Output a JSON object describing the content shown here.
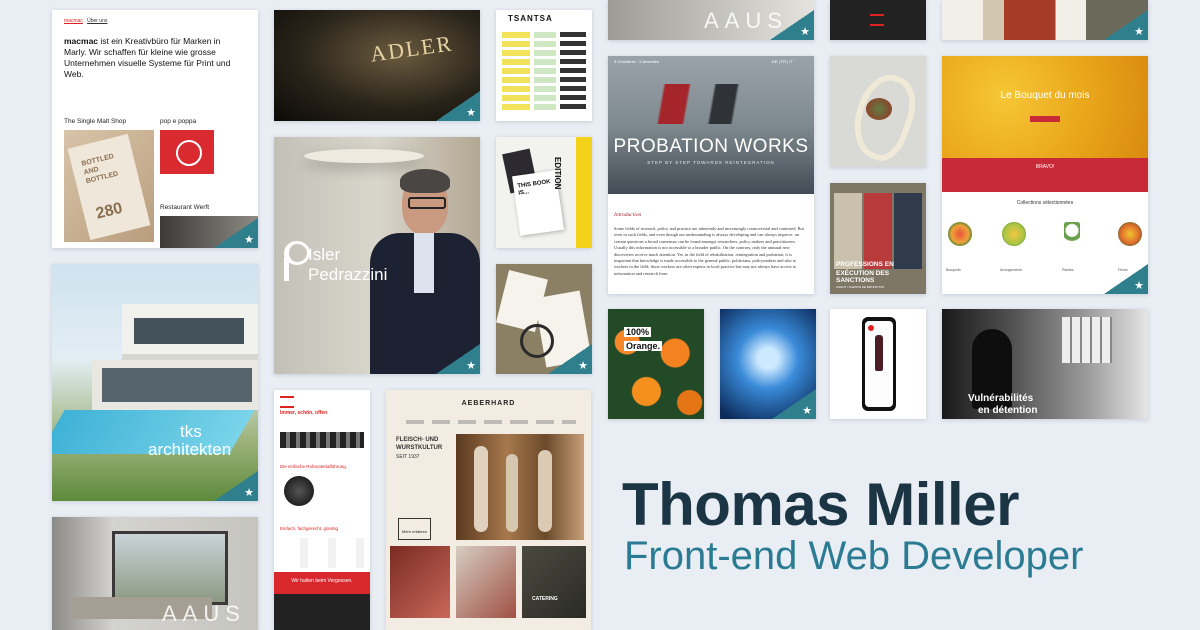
{
  "hero": {
    "name": "Thomas Miller",
    "role": "Front-end Web Developer"
  },
  "tiles": {
    "macmac": {
      "nav": [
        "macmac",
        "Über uns"
      ],
      "intro_brand": "macmac",
      "intro_text": "ist ein Kreativbüro für Marken in Marly. Wir schaffen für kleine wie grosse Unternehmen visuelle Systeme für Print und Web.",
      "project1": "The Single Malt Shop",
      "project2": "pop e poppa",
      "project3": "Restaurant Werft",
      "label_text": "BOTTLED AND BOTTLED",
      "label_number": "280"
    },
    "adler": {
      "sign": "ADLER"
    },
    "tsantsa": {
      "title": "TSANTSA"
    },
    "edition": {
      "label": "EDITION",
      "book": "THIS BOOK IS..."
    },
    "isler": {
      "line1": "Isler",
      "line2": "Pedrazzini"
    },
    "probation": {
      "nav_left": "4 Chambres · 6 Amenités",
      "lang": "DE | FR | IT",
      "title": "PROBATION WORKS",
      "subtitle": "STEP BY STEP TOWARDS REINTEGRATION",
      "section": "Introduction",
      "body": "Some fields of research, policy and practice are inherently and increasingly controversial and contested. But even in such fields, and even though our understanding is always developing and can always improve, on certain questions a broad consensus can be found amongst researchers, policy makers and practitioners. Usually this information is not accessible to a broader public. On the contrary, only the unusual new discoveries receive much attention. Yet, in the field of rehabilitation, reintegration and probation, it is important that knowledge is made accessible to the general public, politicians, policymakers and also to workers in the field; those workers are often experts in local practice but may not always have access to information and research from"
    },
    "bouquet": {
      "title": "Le Bouquet du mois",
      "bravo": "BRAVO!",
      "collections": "Collections sélectionnées",
      "items": [
        "Bouquets",
        "Arrangements",
        "Plantes",
        "Fleurs"
      ]
    },
    "professions": {
      "line1": "PROFESSIONS EN",
      "line2": "EXÉCUTION DES SANCTIONS",
      "footer": "AGENT / AGENTE DE DÉTENTION"
    },
    "orange": {
      "line1": "100%",
      "line2": "Orange."
    },
    "tks": {
      "line1": "tks",
      "line2": "architekten"
    },
    "aebersold": {
      "brand": "AEBERHARD",
      "headline": "FLEISCH- UND WURSTKULTUR",
      "since": "SEIT 1937",
      "button": "Mehr erfahren",
      "catering": "CATERING"
    },
    "promo": {
      "headline": "Immer, schön, offen",
      "section": "Die einfache Rohmaterialführung.",
      "tagline": "Einfach, fachgerecht, günstig",
      "cta": "Wir halten beim Vergessen."
    },
    "vulnerabilites": {
      "line1": "Vulnérabilités",
      "line2": "en détention"
    },
    "aaus": {
      "logo": "AAUS"
    }
  },
  "colors": {
    "background": "#e9edf4",
    "accent_teal": "#2f7f8c",
    "name_dark": "#1b3545",
    "role_teal": "#2b7c93",
    "bouquet_yellow": "#f0b21f",
    "bouquet_red": "#c92a38",
    "tsantsa_yellow": "#f1e25a"
  },
  "icons": {
    "corner_badge": "star-icon",
    "isler_logo": "p-logo-icon"
  }
}
